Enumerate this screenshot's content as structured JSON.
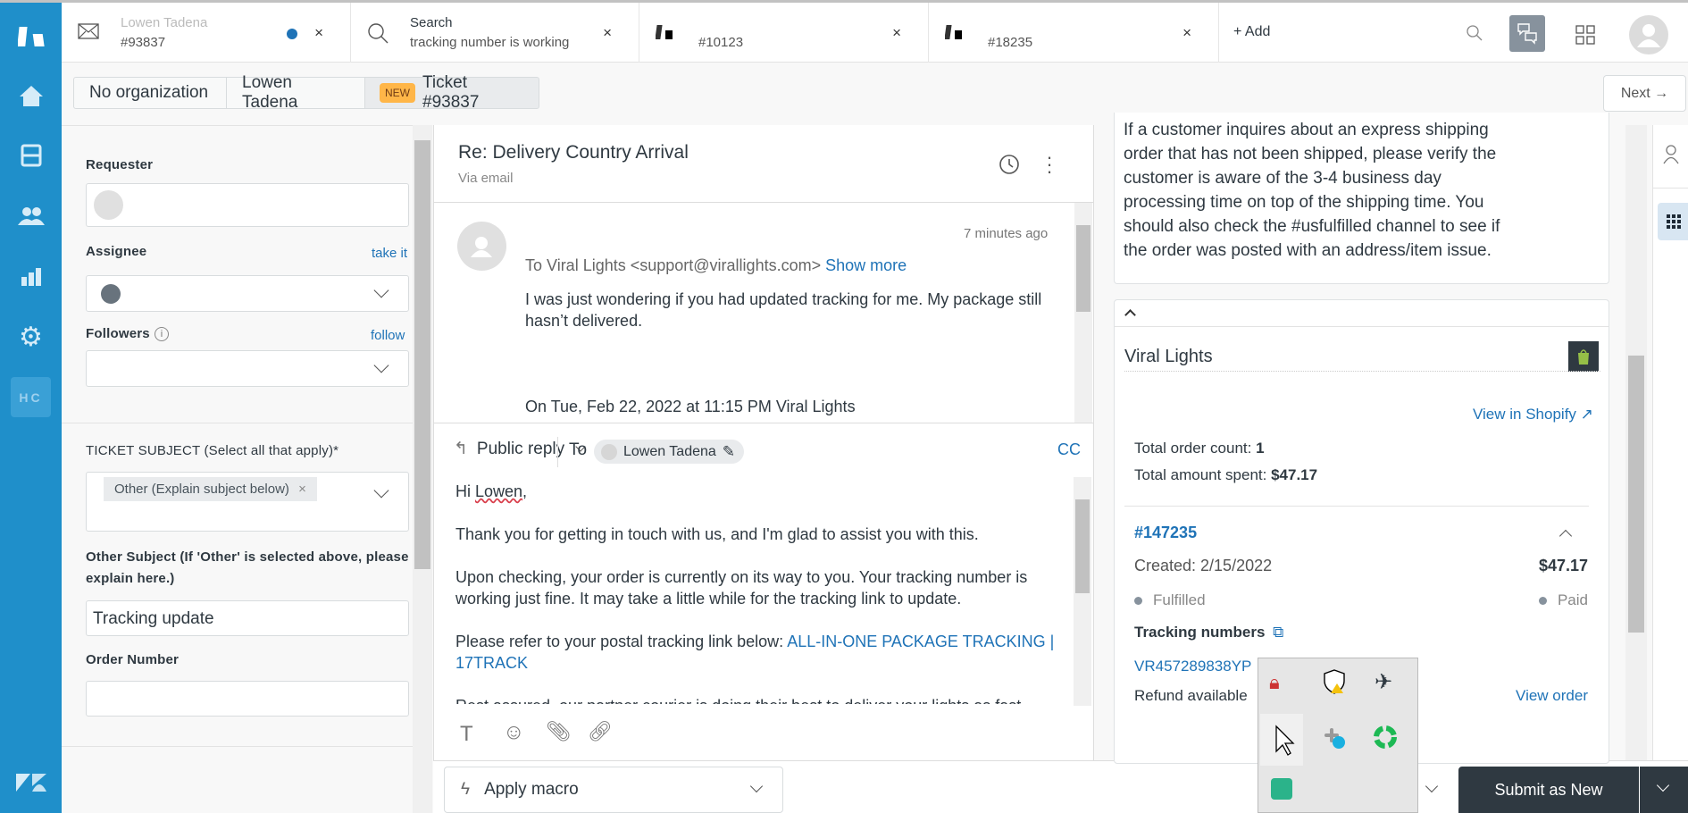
{
  "tabs": [
    {
      "title": "Lowen Tadena",
      "subtitle": "#93837",
      "icon": "mail-icon",
      "unread": true
    },
    {
      "title": "Search",
      "subtitle": "tracking number is working",
      "icon": "search-icon"
    },
    {
      "title": "",
      "subtitle": "#10123",
      "icon": "zendesk-ticket-icon"
    },
    {
      "title": "",
      "subtitle": "#18235",
      "icon": "zendesk-ticket-icon"
    }
  ],
  "add_tab": "+ Add",
  "breadcrumb": {
    "org": "No organization",
    "user": "Lowen Tadena",
    "badge": "NEW",
    "ticket": "Ticket #93837"
  },
  "next_button": "Next →",
  "nav": {
    "hc": "HC"
  },
  "left_panel": {
    "requester_label": "Requester",
    "assignee_label": "Assignee",
    "take_it": "take it",
    "followers_label": "Followers",
    "follow": "follow",
    "ticket_subject_label": "TICKET SUBJECT (Select all that apply)*",
    "ticket_subject_tag": "Other (Explain subject below)",
    "other_subject_label": "Other Subject (If 'Other' is selected above, please explain here.)",
    "other_subject_value": "Tracking update",
    "order_number_label": "Order Number",
    "order_number_value": ""
  },
  "conversation": {
    "title": "Re: Delivery Country Arrival",
    "channel": "Via email",
    "message": {
      "time": "7 minutes ago",
      "to": "To Viral Lights <support@virallights.com>",
      "show_more": "Show more",
      "body": "I was just wondering if you had updated tracking for me. My package still hasn’t delivered.",
      "quote": "On Tue, Feb 22, 2022 at 11:15 PM Viral Lights"
    }
  },
  "reply": {
    "mode": "Public reply",
    "to_label": "To",
    "recipient": "Lowen Tadena",
    "cc": "CC",
    "greeting_hi": "Hi ",
    "greeting_name": "Lowen",
    "greeting_end": ",",
    "p1": "Thank you for getting in touch with us, and I'm glad to assist you with this.",
    "p2": "Upon checking, your order is currently on its way to you. Your tracking number is working just fine. It may take a little while for the tracking link to update.",
    "p3": "Please refer to your postal tracking link below: ",
    "p3_link": "ALL-IN-ONE PACKAGE TRACKING | 17TRACK",
    "p4": "Rest assured, our partner courier is doing their best to deliver your lights as fast"
  },
  "apply_macro": "Apply macro",
  "submit": "Submit as New",
  "right_panel": {
    "kb_text": "If a customer inquires about an express shipping order that has not been shipped, please verify the customer is aware of the 3-4 business day processing time on top of the shipping time. You should also check the #usfulfilled channel to see if the order was posted with an address/item issue.",
    "shopify": {
      "store": "Viral Lights",
      "view_in_shopify": "View in Shopify",
      "order_count_label": "Total order count: ",
      "order_count": "1",
      "amount_label": "Total amount spent: ",
      "amount": "$47.17",
      "order": {
        "number": "#147235",
        "created": "Created: 2/15/2022",
        "total": "$47.17",
        "fulfillment": "Fulfilled",
        "payment": "Paid",
        "tracking_label": "Tracking numbers",
        "tracking_number": "VR457289838YP",
        "refund": "Refund available",
        "view_order": "View order"
      }
    }
  },
  "colors": {
    "nav": "#1f8fca",
    "link": "#1f73b7",
    "submit": "#2f3941",
    "badge": "#ffb648"
  }
}
